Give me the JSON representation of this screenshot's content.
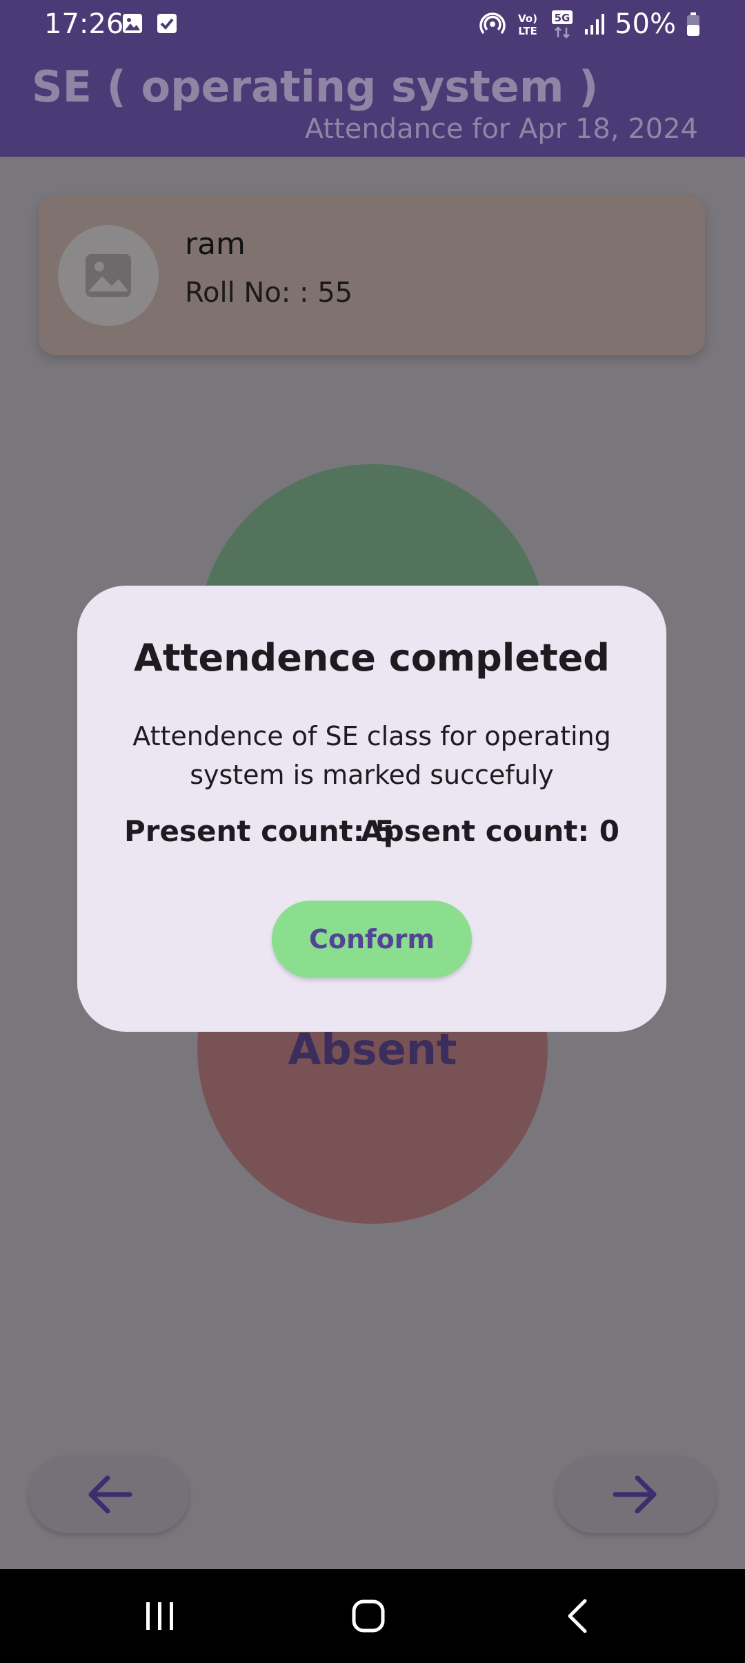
{
  "status_bar": {
    "time": "17:26",
    "battery": "50%",
    "left_icons": [
      "image-icon",
      "checkbox-icon"
    ],
    "right_icons": [
      "hotspot-icon",
      "volte-icon",
      "5g-icon",
      "signal-icon",
      "battery-icon"
    ],
    "volte_top": "Vo)",
    "volte_bottom": "LTE",
    "network": "5G"
  },
  "app_bar": {
    "title": "SE ( operating system  )",
    "subtitle": "Attendance for  Apr 18, 2024"
  },
  "student": {
    "name": "ram",
    "roll": "Roll No: : 55",
    "avatar_icon": "image-placeholder-icon"
  },
  "buttons": {
    "absent_label": "Absent",
    "prev_icon": "arrow-left-icon",
    "next_icon": "arrow-right-icon"
  },
  "dialog": {
    "title": "Attendence completed",
    "message": "Attendence of SE class for operating system  is marked succefuly",
    "present_count": "Present count: 5",
    "absent_count": "Apsent count: 0",
    "confirm_label": "Conform"
  },
  "system_nav": {
    "icons": [
      "recents-icon",
      "home-icon",
      "back-icon"
    ]
  },
  "colors": {
    "app_bar": "#4b3a75",
    "scrim_background": "#7a777c",
    "dialog_background": "#ece6f3",
    "confirm_button": "#8ade8e",
    "confirm_text": "#544497",
    "present_circle": "#54735d",
    "absent_circle": "#785254",
    "arrow": "#3c2e6e"
  }
}
